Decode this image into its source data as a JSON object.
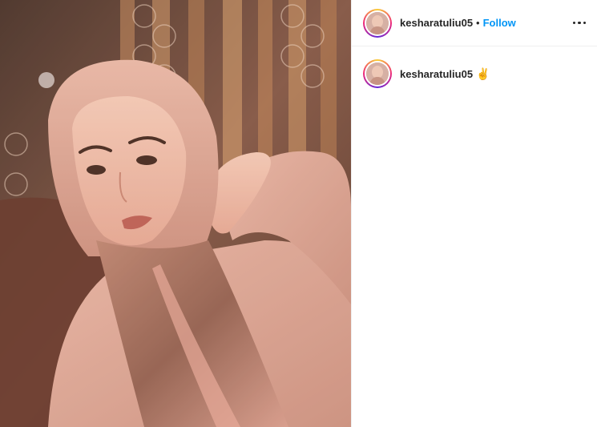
{
  "post": {
    "header": {
      "username": "kesharatuliu05",
      "separator": "•",
      "follow_label": "Follow",
      "more_icon": "more-horizontal-icon"
    },
    "caption": {
      "username": "kesharatuliu05",
      "text": "✌"
    },
    "photo": {
      "description_icon": "photo"
    }
  },
  "colors": {
    "follow": "#0095f6",
    "text": "#262626",
    "divider": "#efefef"
  }
}
